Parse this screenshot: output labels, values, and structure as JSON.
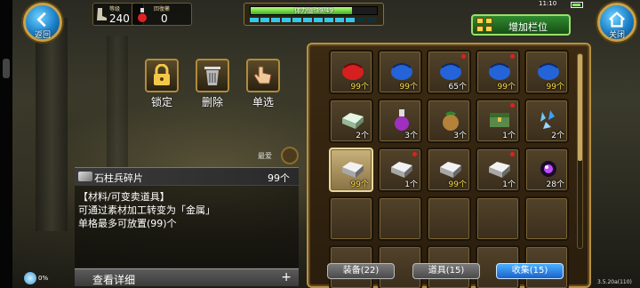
{
  "top": {
    "back_label": "返回",
    "close_label": "关闭",
    "level_caption": "等级",
    "level_value": "240",
    "potion_caption": "回復藥",
    "potion_value": "0",
    "hp_text": "体力值:39/49",
    "hp_fraction": 0.8,
    "add_column_label": "增加栏位",
    "clock": "11:10"
  },
  "actions": [
    {
      "label": "锁定",
      "icon": "lock-icon"
    },
    {
      "label": "删除",
      "icon": "trash-icon"
    },
    {
      "label": "单选",
      "icon": "hand-select-icon"
    }
  ],
  "favorite_label": "最爱",
  "item_info": {
    "name": "石柱兵碎片",
    "count": "99个",
    "lines": [
      "【材料/可变卖道具】",
      "可通过素材加工转变为「金属」",
      "单格最多可放置(99)个"
    ],
    "detail_label": "查看详细",
    "detail_plus": "+"
  },
  "status": {
    "percent": "0%"
  },
  "inventory": {
    "slots": [
      {
        "icon": "red-bag",
        "qty": "99个",
        "yellow": true,
        "dot": false
      },
      {
        "icon": "blue-bag",
        "qty": "99个",
        "yellow": true,
        "dot": false
      },
      {
        "icon": "blue-bag",
        "qty": "65个",
        "yellow": false,
        "dot": true
      },
      {
        "icon": "blue-bag",
        "qty": "99个",
        "yellow": true,
        "dot": true
      },
      {
        "icon": "blue-bag",
        "qty": "99个",
        "yellow": true,
        "dot": false
      },
      {
        "icon": "metal-ingot",
        "qty": "2个",
        "yellow": false,
        "dot": false
      },
      {
        "icon": "potion-flask",
        "qty": "3个",
        "yellow": false,
        "dot": false
      },
      {
        "icon": "pouch",
        "qty": "3个",
        "yellow": false,
        "dot": false
      },
      {
        "icon": "green-chest",
        "qty": "1个",
        "yellow": false,
        "dot": true
      },
      {
        "icon": "blue-crystals",
        "qty": "2个",
        "yellow": false,
        "dot": false
      },
      {
        "icon": "silver-ingot",
        "qty": "99个",
        "yellow": true,
        "dot": false,
        "selected": true
      },
      {
        "icon": "silver-ingot",
        "qty": "1个",
        "yellow": false,
        "dot": true
      },
      {
        "icon": "silver-ingot",
        "qty": "99个",
        "yellow": true,
        "dot": false
      },
      {
        "icon": "silver-ingot",
        "qty": "1个",
        "yellow": false,
        "dot": true
      },
      {
        "icon": "purple-orb",
        "qty": "28个",
        "yellow": false,
        "dot": false
      },
      {
        "icon": "",
        "qty": "",
        "yellow": false,
        "dot": false
      },
      {
        "icon": "",
        "qty": "",
        "yellow": false,
        "dot": false
      },
      {
        "icon": "",
        "qty": "",
        "yellow": false,
        "dot": false
      },
      {
        "icon": "",
        "qty": "",
        "yellow": false,
        "dot": false
      },
      {
        "icon": "",
        "qty": "",
        "yellow": false,
        "dot": false
      },
      {
        "icon": "",
        "qty": "",
        "yellow": false,
        "dot": false
      },
      {
        "icon": "",
        "qty": "",
        "yellow": false,
        "dot": false
      },
      {
        "icon": "",
        "qty": "",
        "yellow": false,
        "dot": false
      },
      {
        "icon": "",
        "qty": "",
        "yellow": false,
        "dot": false
      },
      {
        "icon": "",
        "qty": "",
        "yellow": false,
        "dot": false
      }
    ],
    "tabs": [
      {
        "label": "装备(22)",
        "active": false
      },
      {
        "label": "道具(15)",
        "active": false
      },
      {
        "label": "收集(15)",
        "active": true
      }
    ]
  },
  "version": "3.5.20a(110)"
}
